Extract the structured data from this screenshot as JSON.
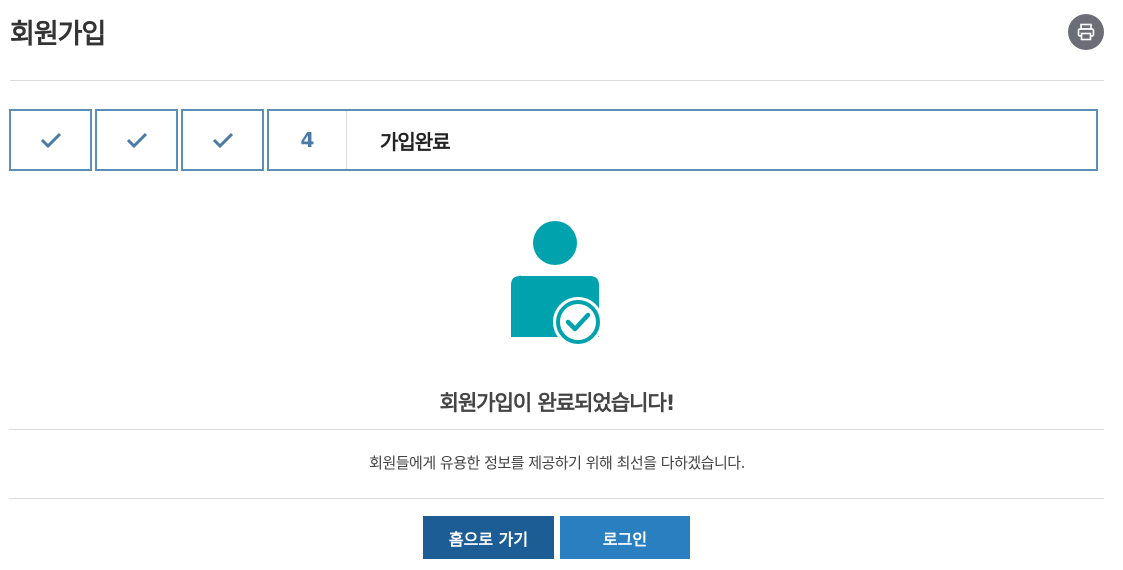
{
  "header": {
    "title": "회원가입",
    "print_icon": "printer-icon"
  },
  "steps": {
    "completed_icon": "check-icon",
    "current_number": "4",
    "current_label": "가입완료"
  },
  "result": {
    "icon": "user-check-icon",
    "message": "회원가입이 완료되었습니다!",
    "sub_message": "회원들에게 유용한 정보를 제공하기 위해 최선을 다하겠습니다."
  },
  "actions": {
    "home_label": "홈으로 가기",
    "login_label": "로그인"
  },
  "colors": {
    "step_border": "#5b8fb5",
    "icon_teal": "#00a3ad",
    "home_button": "#1c5d96",
    "login_button": "#2a7fc0"
  }
}
